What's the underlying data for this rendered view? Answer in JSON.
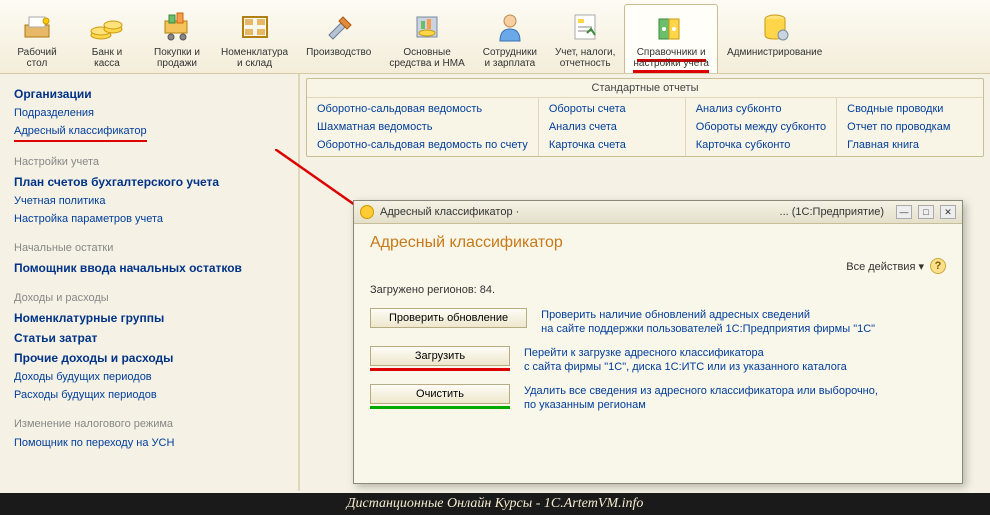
{
  "toolbar": [
    {
      "label": "Рабочий\nстол"
    },
    {
      "label": "Банк и\nкасса"
    },
    {
      "label": "Покупки и\nпродажи"
    },
    {
      "label": "Номенклатура\nи склад"
    },
    {
      "label": "Производство"
    },
    {
      "label": "Основные\nсредства и НМА"
    },
    {
      "label": "Сотрудники\nи зарплата"
    },
    {
      "label": "Учет, налоги,\nотчетность"
    },
    {
      "label": "Справочники и\nнастройки учета"
    },
    {
      "label": "Администрирование"
    }
  ],
  "sidebar": {
    "groups": [
      {
        "links": [
          {
            "text": "Организации",
            "bold": true
          },
          {
            "text": "Подразделения"
          },
          {
            "text": "Адресный классификатор",
            "highlighted": true
          }
        ]
      },
      {
        "title": "Настройки учета",
        "links": [
          {
            "text": "План счетов бухгалтерского учета",
            "bold": true
          },
          {
            "text": "Учетная политика"
          },
          {
            "text": "Настройка параметров учета"
          }
        ]
      },
      {
        "title": "Начальные остатки",
        "links": [
          {
            "text": "Помощник ввода начальных остатков",
            "bold": true
          }
        ]
      },
      {
        "title": "Доходы и расходы",
        "links": [
          {
            "text": "Номенклатурные группы",
            "bold": true
          },
          {
            "text": "Статьи затрат",
            "bold": true
          },
          {
            "text": "Прочие доходы и расходы",
            "bold": true
          },
          {
            "text": "Доходы будущих периодов"
          },
          {
            "text": "Расходы будущих периодов"
          }
        ]
      },
      {
        "title": "Изменение налогового режима",
        "links": [
          {
            "text": "Помощник по переходу на УСН"
          }
        ]
      }
    ]
  },
  "reports_panel": {
    "title": "Стандартные отчеты",
    "cols": [
      [
        "Оборотно-сальдовая ведомость",
        "Шахматная ведомость",
        "Оборотно-сальдовая ведомость по счету"
      ],
      [
        "Обороты счета",
        "Анализ счета",
        "Карточка счета"
      ],
      [
        "Анализ субконто",
        "Обороты между субконто",
        "Карточка субконто"
      ],
      [
        "Сводные проводки",
        "Отчет по проводкам",
        "Главная книга"
      ]
    ]
  },
  "dialog": {
    "title_left": "Адресный классификатор ·",
    "title_right": "... (1С:Предприятие)",
    "heading": "Адресный классификатор",
    "all_actions": "Все действия ▾",
    "status_label": "Загружено регионов:",
    "status_value": "84.",
    "buttons": {
      "check": "Проверить обновление",
      "load": "Загрузить",
      "clear": "Очистить"
    },
    "descs": {
      "check": "Проверить наличие обновлений адресных сведений\nна сайте поддержки пользователей 1С:Предприятия фирмы \"1С\"",
      "load": "Перейти к загрузке адресного классификатора\nс сайта фирмы \"1С\", диска 1С:ИТС или из указанного каталога",
      "clear": "Удалить все сведения из адресного классификатора или выборочно,\nпо указанным регионам"
    }
  },
  "footer": "Дистанционные Онлайн Курсы - 1C.ArtemVM.info"
}
